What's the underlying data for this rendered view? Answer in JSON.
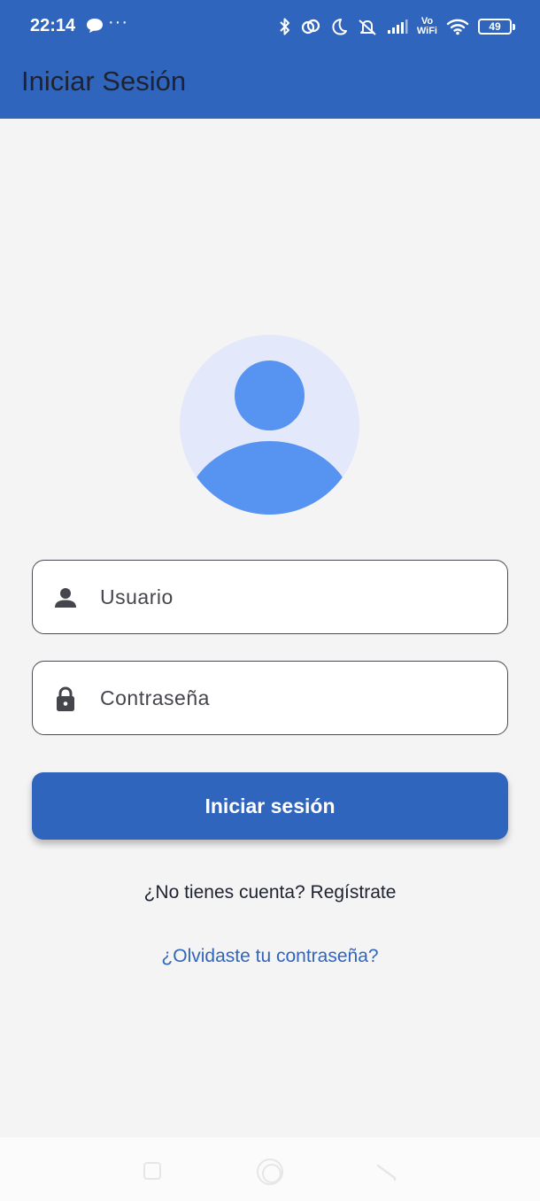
{
  "status_bar": {
    "time": "22:14",
    "notification_icons": [
      "chat-bubble-icon",
      "more-dots-icon"
    ],
    "more_dots": "···",
    "system_icons": [
      "bluetooth-icon",
      "link-icon",
      "moon-icon",
      "alarm-off-icon",
      "signal-icon",
      "vowifi-icon",
      "wifi-icon",
      "battery-icon"
    ],
    "vowifi_top": "Vo",
    "vowifi_bottom": "WiFi",
    "battery_level": "49"
  },
  "app_bar": {
    "title": "Iniciar Sesión",
    "background_color": "#3065bd"
  },
  "avatar": {
    "icon": "user-avatar-icon",
    "background_color": "#e3e9fb",
    "figure_color": "#5793f0"
  },
  "form": {
    "username": {
      "icon": "person-icon",
      "placeholder": "Usuario",
      "value": ""
    },
    "password": {
      "icon": "lock-icon",
      "placeholder": "Contraseña",
      "value": ""
    },
    "submit_label": "Iniciar sesión",
    "register_text": "¿No tienes cuenta? Regístrate",
    "forgot_text": "¿Olvidaste tu contraseña?",
    "accent_color": "#3065bd"
  },
  "nav_bar": {
    "buttons": [
      "recents-icon",
      "home-icon",
      "back-icon"
    ]
  }
}
